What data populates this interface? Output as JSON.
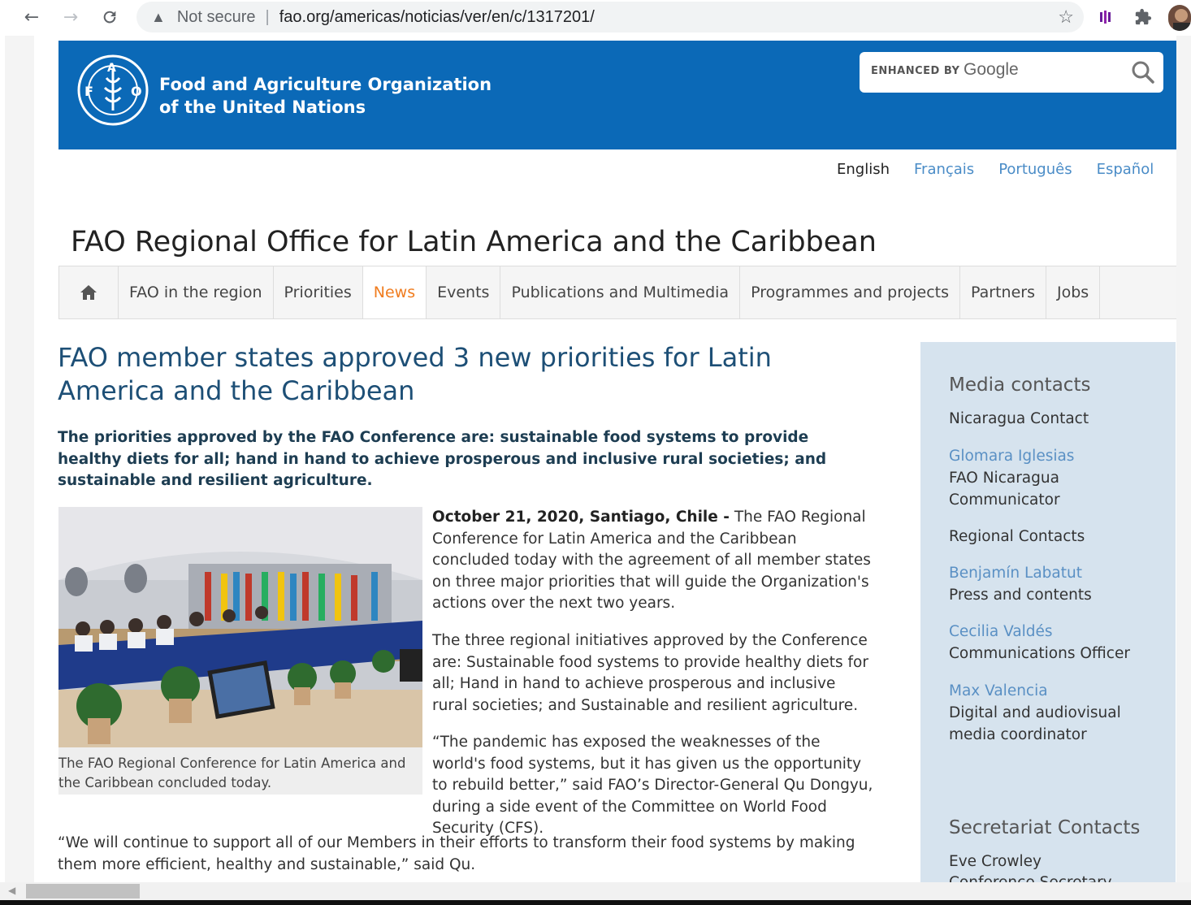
{
  "browser": {
    "back": "←",
    "forward": "→",
    "reload": "C",
    "security_label": "Not secure",
    "url": "fao.org/americas/noticias/ver/en/c/1317201/"
  },
  "header": {
    "org_line1": "Food and Agriculture Organization",
    "org_line2": "of the United Nations",
    "search_enhanced": "ENHANCED BY",
    "search_brand": "Google"
  },
  "languages": [
    "English",
    "Français",
    "Português",
    "Español"
  ],
  "site_title": "FAO Regional Office for Latin America and the Caribbean",
  "nav": [
    "FAO in the region",
    "Priorities",
    "News",
    "Events",
    "Publications and Multimedia",
    "Programmes and projects",
    "Partners",
    "Jobs"
  ],
  "article": {
    "title": "FAO member states approved 3 new priorities for Latin America and the Caribbean",
    "lead": "The priorities approved by the FAO Conference are: sustainable food systems to provide healthy diets for all; hand in hand to achieve prosperous and inclusive rural societies; and sustainable and resilient agriculture.",
    "caption": "The FAO Regional Conference for Latin America and the Caribbean concluded today.",
    "dateline": "October 21, 2020, Santiago, Chile -",
    "p1": "The FAO Regional Conference for Latin America and the Caribbean concluded today with the agreement of all member states on three major priorities that will guide the Organization's actions over the next two years.",
    "p2": "The three regional initiatives approved by the Conference are: Sustainable food systems to provide healthy diets for all; Hand in hand to achieve prosperous and inclusive rural societies; and Sustainable and resilient agriculture.",
    "p3": "“The pandemic has exposed the weaknesses of the world's food systems, but it has given us the opportunity to rebuild better,” said FAO’s Director-General Qu Dongyu, during a side event of the Committee on World Food Security (CFS).",
    "p4": "“We will continue to support all of our Members in their efforts to transform their food systems by making them more efficient, healthy and sustainable,” said Qu."
  },
  "sidebar": {
    "media_heading": "Media contacts",
    "nicaragua_label": "Nicaragua Contact",
    "c1_name": "Glomara Iglesias",
    "c1_role": "FAO Nicaragua Communicator",
    "regional_label": "Regional Contacts",
    "c2_name": "Benjamín Labatut",
    "c2_role": "Press and contents",
    "c3_name": "Cecilia Valdés",
    "c3_role": "Communications Officer",
    "c4_name": "Max Valencia",
    "c4_role": "Digital and audiovisual media coordinator",
    "secretariat_heading": "Secretariat Contacts",
    "c5_name": "Eve Crowley",
    "c5_role": "Conference Secretary"
  }
}
